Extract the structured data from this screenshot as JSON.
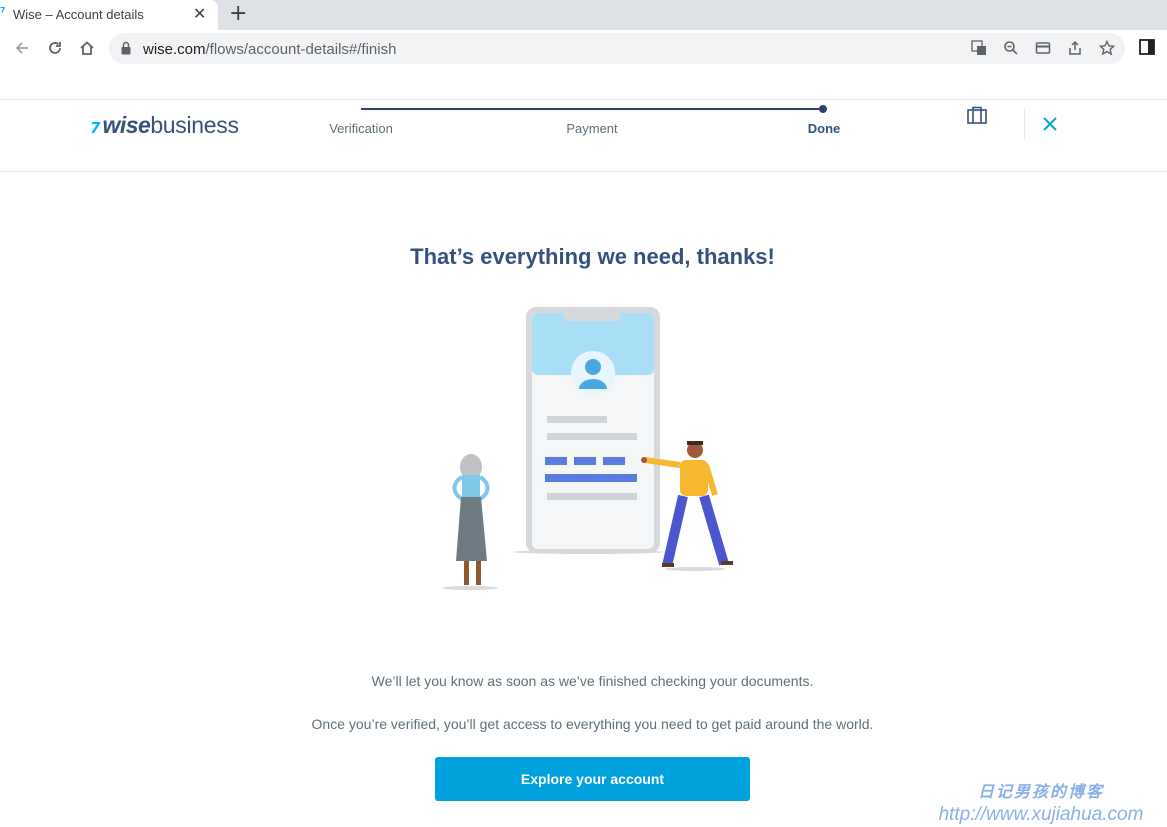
{
  "browser": {
    "tab_title": "Wise – Account details",
    "tab_close": "✕",
    "new_tab": "+",
    "url_host": "wise.com",
    "url_path": "/flows/account-details#/finish"
  },
  "header": {
    "logo_flag": "7",
    "logo_wise": "wise",
    "logo_business": "business",
    "steps": [
      {
        "label": "Verification"
      },
      {
        "label": "Payment"
      },
      {
        "label": "Done"
      }
    ]
  },
  "main": {
    "headline": "That’s everything we need, thanks!",
    "message1": "We’ll let you know as soon as we’ve finished checking your documents.",
    "message2": "Once you’re verified, you’ll get access to everything you need to get paid around the world.",
    "cta_label": "Explore your account"
  },
  "watermark": {
    "line1": "日记男孩的博客",
    "line2": "http://www.xujiahua.com"
  },
  "colors": {
    "accent": "#00a2dd",
    "navy": "#37517e",
    "brand_flag": "#00b9ff"
  }
}
